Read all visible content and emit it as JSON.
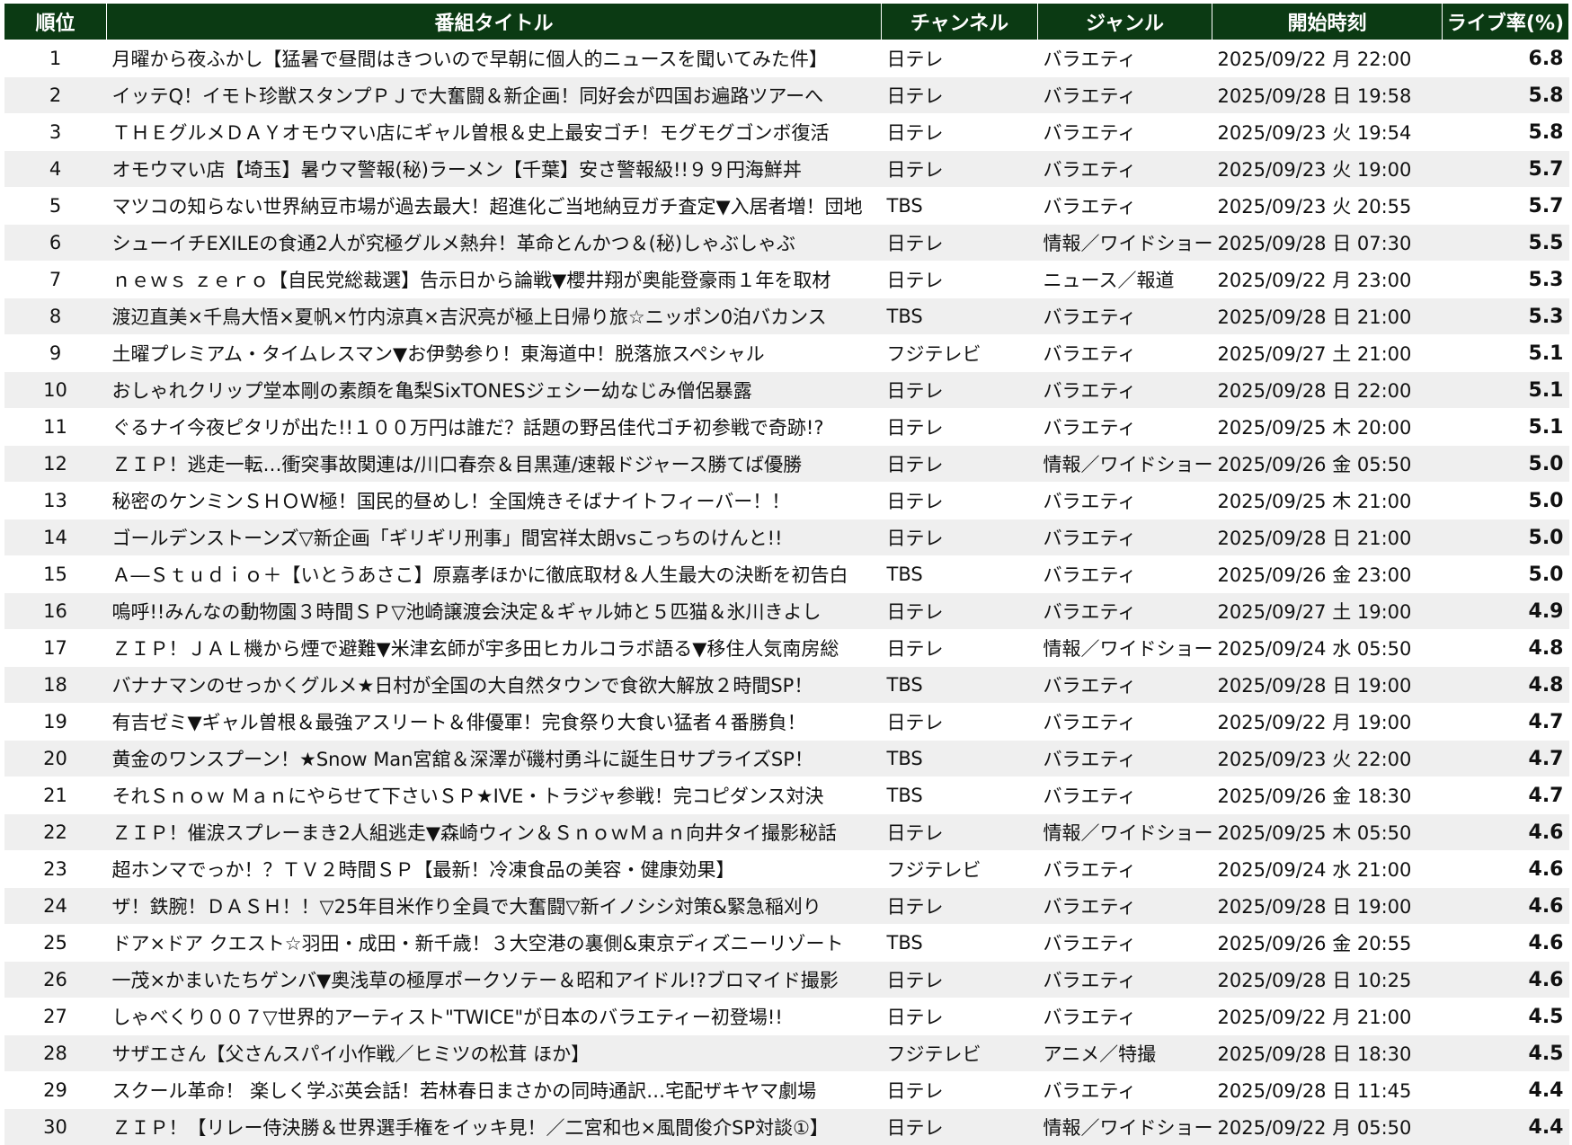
{
  "table": {
    "headers": [
      "順位",
      "番組タイトル",
      "チャンネル",
      "ジャンル",
      "開始時刻",
      "ライブ率(%)"
    ],
    "rows": [
      [
        "1",
        "月曜から夜ふかし【猛暑で昼間はきついので早朝に個人的ニュースを聞いてみた件】",
        "日テレ",
        "バラエティ",
        "2025/09/22 月 22:00",
        "6.8"
      ],
      [
        "2",
        "イッテQ！イモト珍獣スタンプＰＪで大奮闘＆新企画！同好会が四国お遍路ツアーへ",
        "日テレ",
        "バラエティ",
        "2025/09/28 日 19:58",
        "5.8"
      ],
      [
        "3",
        "ＴＨＥグルメＤＡＹオモウマい店にギャル曽根＆史上最安ゴチ！モグモグゴンボ復活",
        "日テレ",
        "バラエティ",
        "2025/09/23 火 19:54",
        "5.8"
      ],
      [
        "4",
        "オモウマい店【埼玉】暑ウマ警報(秘)ラーメン【千葉】安さ警報級!!９９円海鮮丼",
        "日テレ",
        "バラエティ",
        "2025/09/23 火 19:00",
        "5.7"
      ],
      [
        "5",
        "マツコの知らない世界納豆市場が過去最大！超進化ご当地納豆ガチ査定▼入居者増！団地",
        "TBS",
        "バラエティ",
        "2025/09/23 火 20:55",
        "5.7"
      ],
      [
        "6",
        "シューイチEXILEの食通2人が究極グルメ熱弁！革命とんかつ＆(秘)しゃぶしゃぶ",
        "日テレ",
        "情報／ワイドショー",
        "2025/09/28 日 07:30",
        "5.5"
      ],
      [
        "7",
        "ｎｅｗｓ ｚｅｒｏ【自民党総裁選】告示日から論戦▼櫻井翔が奥能登豪雨１年を取材",
        "日テレ",
        "ニュース／報道",
        "2025/09/22 月 23:00",
        "5.3"
      ],
      [
        "8",
        "渡辺直美×千鳥大悟×夏帆×竹内涼真×吉沢亮が極上日帰り旅☆ニッポン0泊バカンス",
        "TBS",
        "バラエティ",
        "2025/09/28 日 21:00",
        "5.3"
      ],
      [
        "9",
        "土曜プレミアム・タイムレスマン▼お伊勢参り！東海道中！脱落旅スペシャル",
        "フジテレビ",
        "バラエティ",
        "2025/09/27 土 21:00",
        "5.1"
      ],
      [
        "10",
        "おしゃれクリップ堂本剛の素顔を亀梨SixTONESジェシー幼なじみ僧侶暴露",
        "日テレ",
        "バラエティ",
        "2025/09/28 日 22:00",
        "5.1"
      ],
      [
        "11",
        "ぐるナイ今夜ピタリが出た!!１００万円は誰だ？話題の野呂佳代ゴチ初参戦で奇跡!?",
        "日テレ",
        "バラエティ",
        "2025/09/25 木 20:00",
        "5.1"
      ],
      [
        "12",
        "ＺＩＰ！逃走一転…衝突事故関連は/川口春奈＆目黒蓮/速報ドジャース勝てば優勝",
        "日テレ",
        "情報／ワイドショー",
        "2025/09/26 金 05:50",
        "5.0"
      ],
      [
        "13",
        "秘密のケンミンＳＨＯＷ極！国民的昼めし！全国焼きそばナイトフィーバー！！",
        "日テレ",
        "バラエティ",
        "2025/09/25 木 21:00",
        "5.0"
      ],
      [
        "14",
        "ゴールデンストーンズ▽新企画「ギリギリ刑事」間宮祥太朗vsこっちのけんと!!",
        "日テレ",
        "バラエティ",
        "2025/09/28 日 21:00",
        "5.0"
      ],
      [
        "15",
        "Ａ―Ｓｔｕｄｉｏ＋【いとうあさこ】原嘉孝ほかに徹底取材＆人生最大の決断を初告白",
        "TBS",
        "バラエティ",
        "2025/09/26 金 23:00",
        "5.0"
      ],
      [
        "16",
        "嗚呼!!みんなの動物園３時間ＳＰ▽池崎譲渡会決定＆ギャル姉と５匹猫＆氷川きよし",
        "日テレ",
        "バラエティ",
        "2025/09/27 土 19:00",
        "4.9"
      ],
      [
        "17",
        "ＺＩＰ！ＪＡＬ機から煙で避難▼米津玄師が宇多田ヒカルコラボ語る▼移住人気南房総",
        "日テレ",
        "情報／ワイドショー",
        "2025/09/24 水 05:50",
        "4.8"
      ],
      [
        "18",
        "バナナマンのせっかくグルメ★日村が全国の大自然タウンで食欲大解放２時間SP！",
        "TBS",
        "バラエティ",
        "2025/09/28 日 19:00",
        "4.8"
      ],
      [
        "19",
        "有吉ゼミ▼ギャル曽根＆最強アスリート＆俳優軍！完食祭り大食い猛者４番勝負！",
        "日テレ",
        "バラエティ",
        "2025/09/22 月 19:00",
        "4.7"
      ],
      [
        "20",
        "黄金のワンスプーン！★Snow Man宮舘＆深澤が磯村勇斗に誕生日サプライズSP！",
        "TBS",
        "バラエティ",
        "2025/09/23 火 22:00",
        "4.7"
      ],
      [
        "21",
        "それＳｎｏｗ Ｍａｎにやらせて下さいＳＰ★IVE・トラジャ参戦！完コピダンス対決",
        "TBS",
        "バラエティ",
        "2025/09/26 金 18:30",
        "4.7"
      ],
      [
        "22",
        "ＺＩＰ！催涙スプレーまき2人組逃走▼森崎ウィン＆ＳｎｏｗＭａｎ向井タイ撮影秘話",
        "日テレ",
        "情報／ワイドショー",
        "2025/09/25 木 05:50",
        "4.6"
      ],
      [
        "23",
        "超ホンマでっか！？ＴＶ２時間ＳＰ【最新！冷凍食品の美容・健康効果】",
        "フジテレビ",
        "バラエティ",
        "2025/09/24 水 21:00",
        "4.6"
      ],
      [
        "24",
        "ザ！鉄腕！ＤＡＳＨ！！▽25年目米作り全員で大奮闘▽新イノシシ対策&緊急稲刈り",
        "日テレ",
        "バラエティ",
        "2025/09/28 日 19:00",
        "4.6"
      ],
      [
        "25",
        "ドア×ドア クエスト☆羽田・成田・新千歳！３大空港の裏側&東京ディズニーリゾート",
        "TBS",
        "バラエティ",
        "2025/09/26 金 20:55",
        "4.6"
      ],
      [
        "26",
        "一茂×かまいたちゲンバ▼奥浅草の極厚ポークソテー＆昭和アイドル!?ブロマイド撮影",
        "日テレ",
        "バラエティ",
        "2025/09/28 日 10:25",
        "4.6"
      ],
      [
        "27",
        "しゃべくり００７▽世界的アーティスト\"TWICE\"が日本のバラエティー初登場!!",
        "日テレ",
        "バラエティ",
        "2025/09/22 月 21:00",
        "4.5"
      ],
      [
        "28",
        "サザエさん【父さんスパイ小作戦／ヒミツの松茸 ほか】",
        "フジテレビ",
        "アニメ／特撮",
        "2025/09/28 日 18:30",
        "4.5"
      ],
      [
        "29",
        "スクール革命！ 楽しく学ぶ英会話！若林春日まさかの同時通訳…宅配ザキヤマ劇場",
        "日テレ",
        "バラエティ",
        "2025/09/28 日 11:45",
        "4.4"
      ],
      [
        "30",
        "ＺＩＰ！【リレー侍決勝＆世界選手権をイッキ見！／二宮和也×風間俊介SP対談①】",
        "日テレ",
        "情報／ワイドショー",
        "2025/09/22 月 05:50",
        "4.4"
      ]
    ]
  },
  "colors": {
    "header_bg": "#0b3a13",
    "header_text": "#ffffff",
    "row_alt_bg": "#efefef"
  }
}
